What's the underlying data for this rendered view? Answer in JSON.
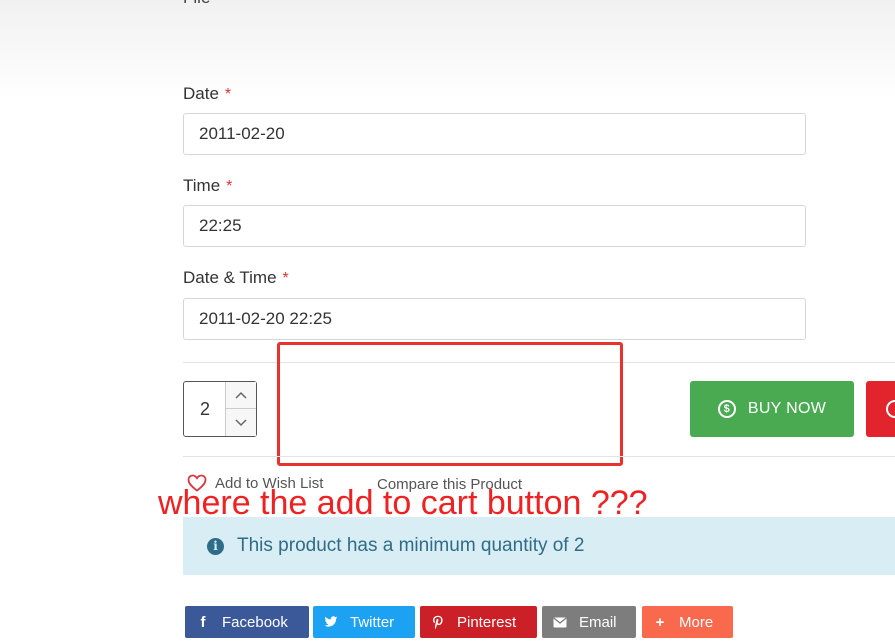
{
  "form": {
    "file_label_partial": "File",
    "fields": [
      {
        "label": "Date",
        "required_mark": "*",
        "value": "2011-02-20"
      },
      {
        "label": "Time",
        "required_mark": "*",
        "value": "22:25"
      },
      {
        "label": "Date & Time",
        "required_mark": "*",
        "value": "2011-02-20 22:25"
      }
    ]
  },
  "purchase": {
    "quantity": "2",
    "buy_now_label": "BUY NOW",
    "buy_now_icon": "dollar-circle-icon",
    "colors": {
      "buy_now": "#4aaa52",
      "secondary_button": "#e2242c"
    }
  },
  "links": {
    "wishlist": "Add to Wish List",
    "wishlist_icon": "heart-icon",
    "compare": "Compare this Product"
  },
  "annotation": {
    "text": "where the add to cart button ???",
    "color": "#ee2222"
  },
  "alert": {
    "text": "This product has a minimum quantity of 2",
    "icon": "info-circle-icon"
  },
  "share": [
    {
      "label": "Facebook",
      "icon": "facebook-icon",
      "color": "#3b5998"
    },
    {
      "label": "Twitter",
      "icon": "twitter-icon",
      "color": "#1da1f2"
    },
    {
      "label": "Pinterest",
      "icon": "pinterest-icon",
      "color": "#cb2027"
    },
    {
      "label": "Email",
      "icon": "envelope-icon",
      "color": "#7d7d7d"
    },
    {
      "label": "More",
      "icon": "plus-icon",
      "color": "#f8694d"
    }
  ]
}
